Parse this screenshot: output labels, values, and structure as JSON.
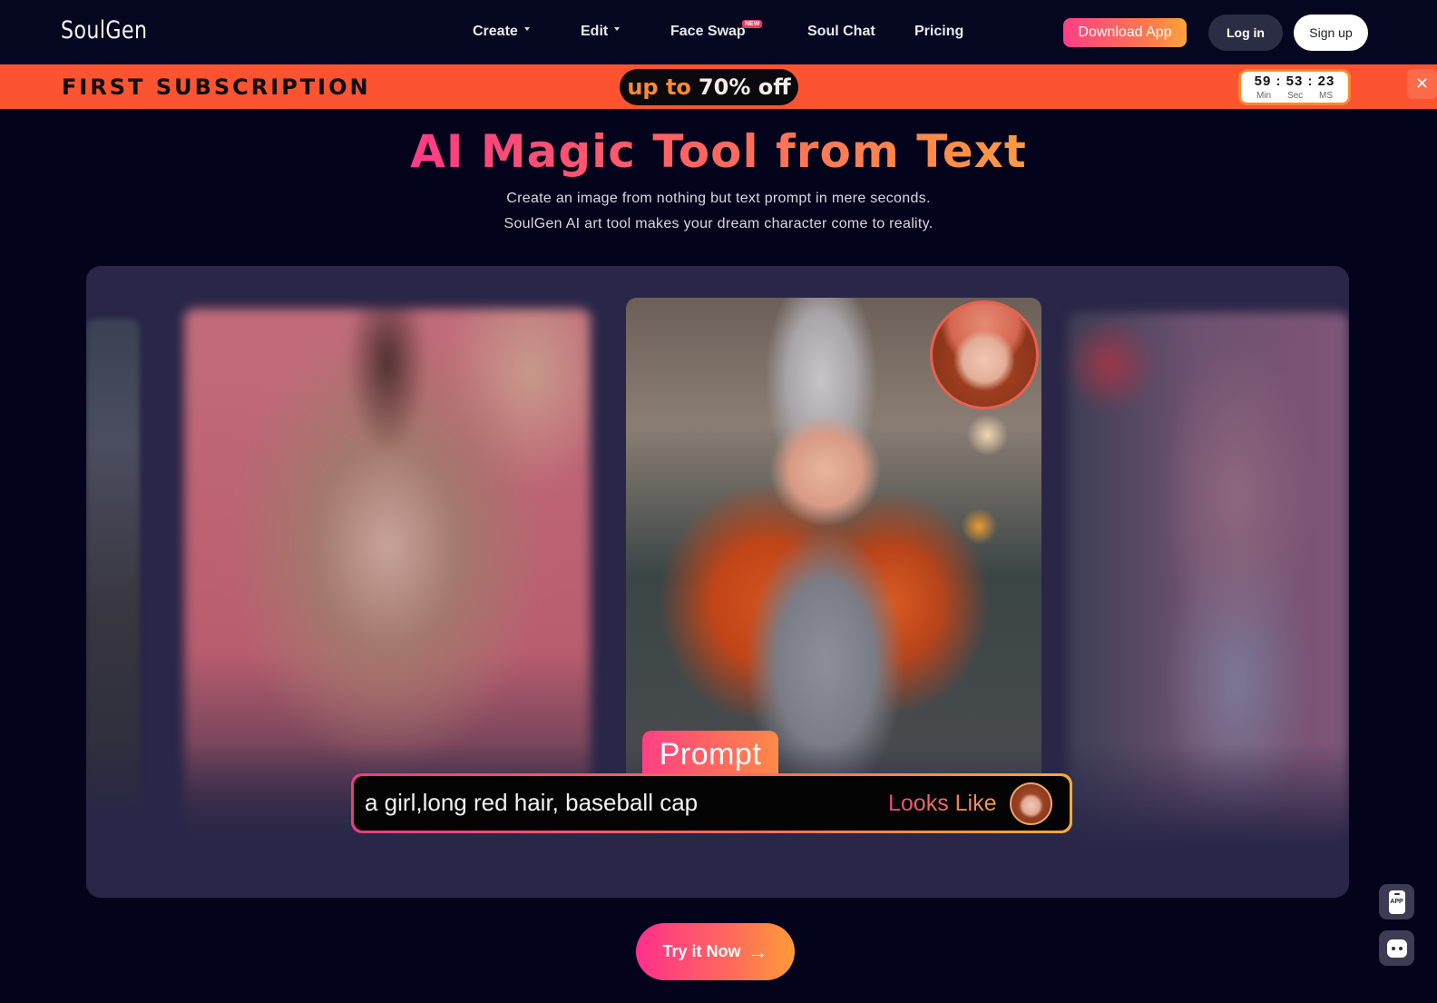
{
  "header": {
    "logo": "SoulGen",
    "nav": [
      {
        "label": "Create",
        "has_dropdown": true
      },
      {
        "label": "Edit",
        "has_dropdown": true
      },
      {
        "label": "Face Swap",
        "badge": "NEW"
      },
      {
        "label": "Soul Chat"
      },
      {
        "label": "Pricing"
      }
    ],
    "download_label": "Download App",
    "login_label": "Log in",
    "signup_label": "Sign up"
  },
  "promo": {
    "title": "FIRST SUBSCRIPTION",
    "offer_prefix": "up to",
    "offer_value": "70% off",
    "timer": {
      "display": "59 : 53 : 23",
      "min": "59",
      "sec": "53",
      "ms": "23",
      "labels": [
        "Min",
        "Sec",
        "MS"
      ]
    },
    "close_glyph": "✕"
  },
  "hero": {
    "title": "AI Magic Tool from Text",
    "subtitle_line1": "Create an image from nothing but text prompt in mere seconds.",
    "subtitle_line2": "SoulGen AI art tool makes your dream character come to reality."
  },
  "showcase": {
    "prompt_tab_label": "Prompt",
    "prompt_text": "a girl,long red hair, baseball cap",
    "looks_like_label": "Looks Like"
  },
  "cta": {
    "label": "Try it Now",
    "arrow": "→"
  },
  "floating": {
    "app_label": "APP"
  },
  "colors": {
    "background": "#03041c",
    "promo": "#fc5430",
    "accent_pink": "#ff3f86",
    "accent_orange": "#ff9b37",
    "panel": "#292647"
  }
}
